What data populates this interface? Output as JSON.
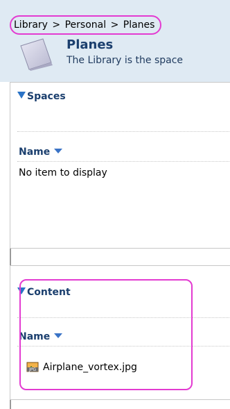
{
  "breadcrumb": {
    "items": [
      "Library",
      "Personal",
      "Planes"
    ],
    "separator": ">"
  },
  "header": {
    "title": "Planes",
    "description": "The Library is the space"
  },
  "spaces_panel": {
    "title": "Spaces",
    "column_name": "Name",
    "empty_message": "No item to display"
  },
  "content_panel": {
    "title": "Content",
    "column_name": "Name",
    "items": [
      {
        "name": "Airplane_vortex.jpg",
        "icon": "jpg-file-icon"
      }
    ]
  },
  "colors": {
    "highlight": "#e33bd1",
    "title_text": "#1b3f6e",
    "header_band": "#dfeaf3",
    "triangle_blue": "#2a73c6"
  }
}
